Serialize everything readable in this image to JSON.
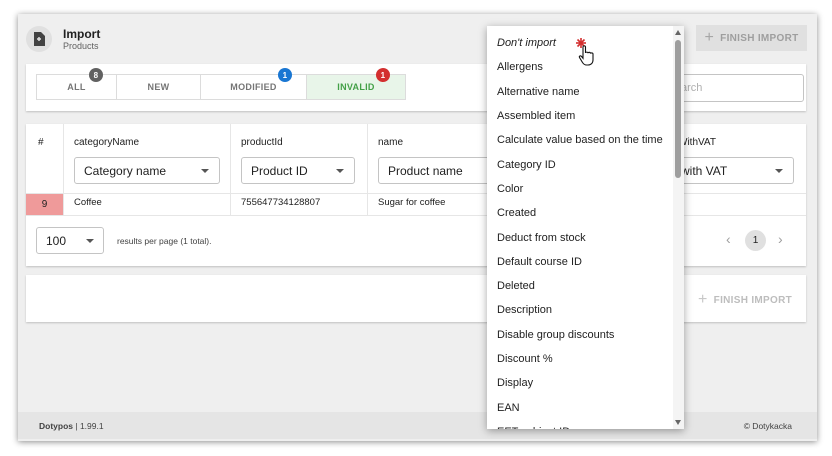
{
  "header": {
    "title": "Import",
    "subtitle": "Products",
    "finish_label": "FINISH IMPORT",
    "icon": "file-import-icon"
  },
  "tabs": [
    {
      "label": "ALL",
      "badge": "8",
      "badge_color": "#616161",
      "active": false
    },
    {
      "label": "NEW",
      "badge": "",
      "active": false
    },
    {
      "label": "MODIFIED",
      "badge": "1",
      "badge_color": "#1976d2",
      "active": false
    },
    {
      "label": "INVALID",
      "badge": "1",
      "badge_color": "#d32f2f",
      "active": true
    }
  ],
  "search": {
    "placeholder_visible": "arch"
  },
  "table": {
    "columns": [
      {
        "header": "#",
        "select": ""
      },
      {
        "header": "categoryName",
        "select": "Category name"
      },
      {
        "header": "productId",
        "select": "Product ID"
      },
      {
        "header": "name",
        "select": "Product name"
      },
      {
        "header": "WithVAT",
        "select": "e with VAT"
      }
    ],
    "rows": [
      {
        "num": "9",
        "categoryName": "Coffee",
        "productId": "755647734128807",
        "name": "Sugar for coffee"
      }
    ],
    "per_page": "100",
    "per_page_label": "results per page (1 total).",
    "page": "1"
  },
  "bottom": {
    "finish_label": "FINISH IMPORT"
  },
  "footer": {
    "app": "Dotypos",
    "version": "| 1.99.1",
    "copyright": "© Dotykacka"
  },
  "dropdown": {
    "options": [
      "Don't import",
      "Allergens",
      "Alternative name",
      "Assembled item",
      "Calculate value based on the time",
      "Category ID",
      "Color",
      "Created",
      "Deduct from stock",
      "Default course ID",
      "Deleted",
      "Description",
      "Disable group discounts",
      "Discount %",
      "Display",
      "EAN",
      "EET subject ID"
    ]
  },
  "colors": {
    "invalid_row": "#ef9a9a",
    "active_tab_bg": "#e8f5e9",
    "active_tab_text": "#43a047"
  }
}
